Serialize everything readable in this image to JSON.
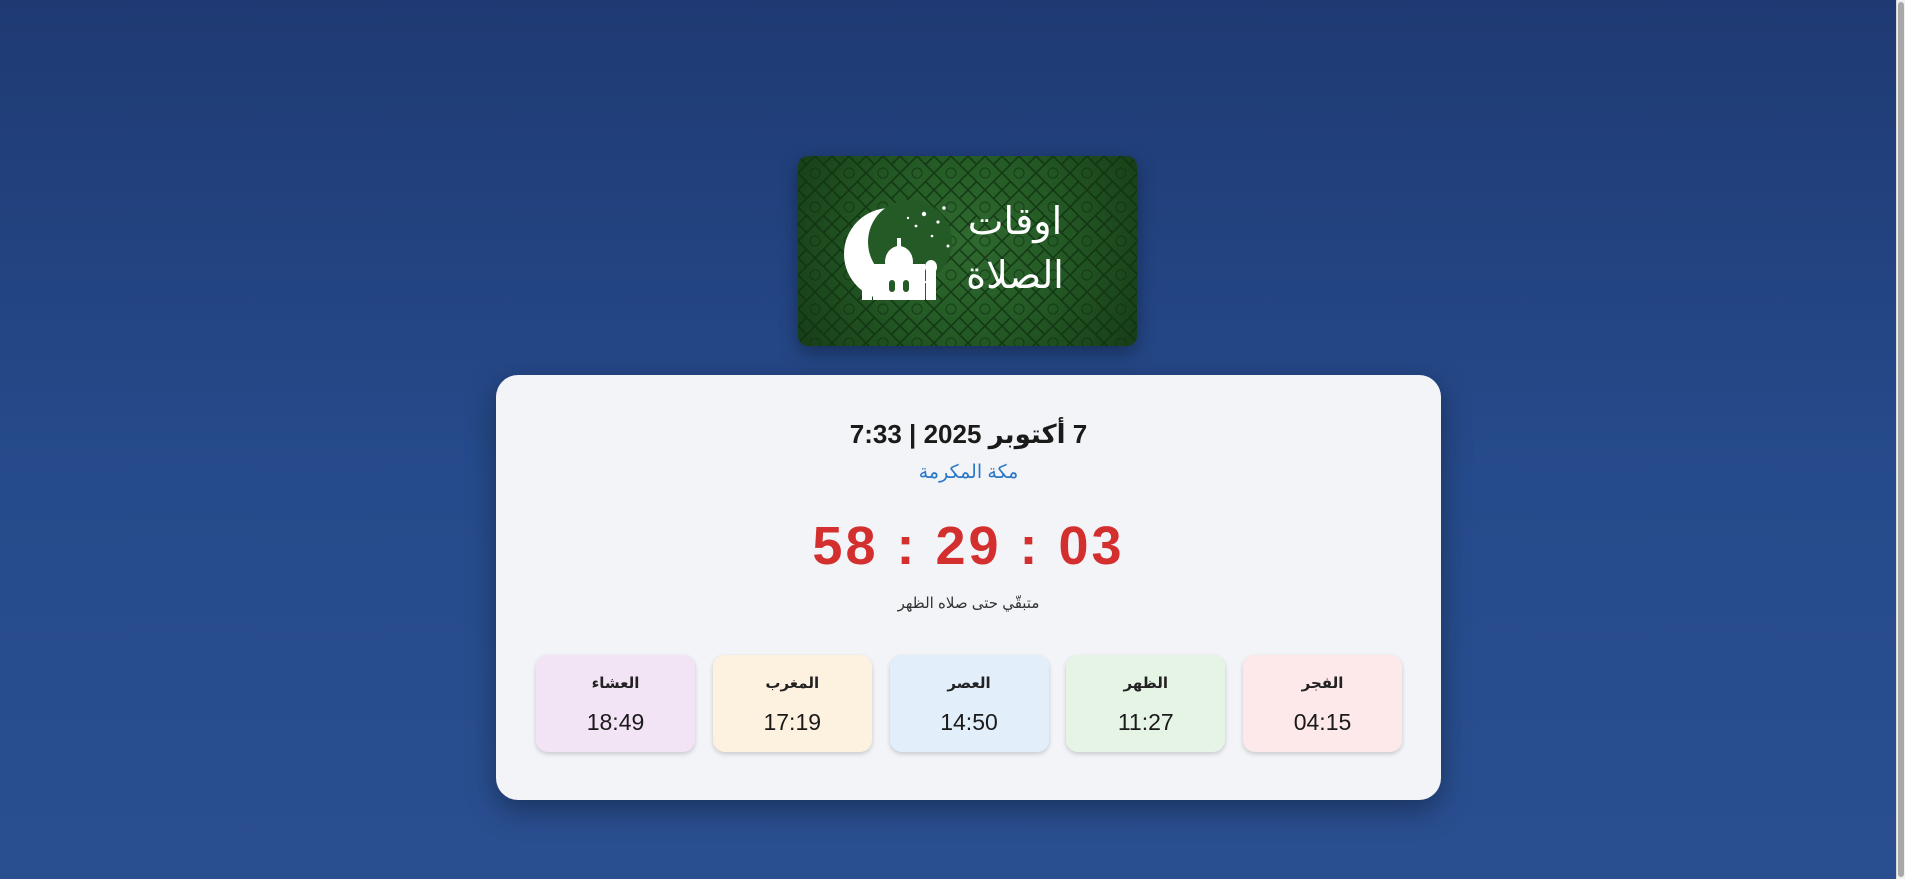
{
  "logo": {
    "line1": "اوقات",
    "line2": "الصلاة",
    "icon": "crescent-mosque-icon",
    "background_color": "#245a25"
  },
  "header": {
    "date_time": "7 أكتوبر 2025 | 7:33",
    "city": "مكة المكرمة"
  },
  "countdown": {
    "time": "58 : 29 : 03",
    "label": "متبقّي حتى صلاه الظهر",
    "color": "#d32f2f"
  },
  "prayers": [
    {
      "name": "الفجر",
      "time": "04:15",
      "color": "#fde8ea"
    },
    {
      "name": "الظهر",
      "time": "11:27",
      "color": "#e6f4e6"
    },
    {
      "name": "العصر",
      "time": "14:50",
      "color": "#e2effa"
    },
    {
      "name": "المغرب",
      "time": "17:19",
      "color": "#fdf2e0"
    },
    {
      "name": "العشاء",
      "time": "18:49",
      "color": "#f2e4f5"
    }
  ]
}
